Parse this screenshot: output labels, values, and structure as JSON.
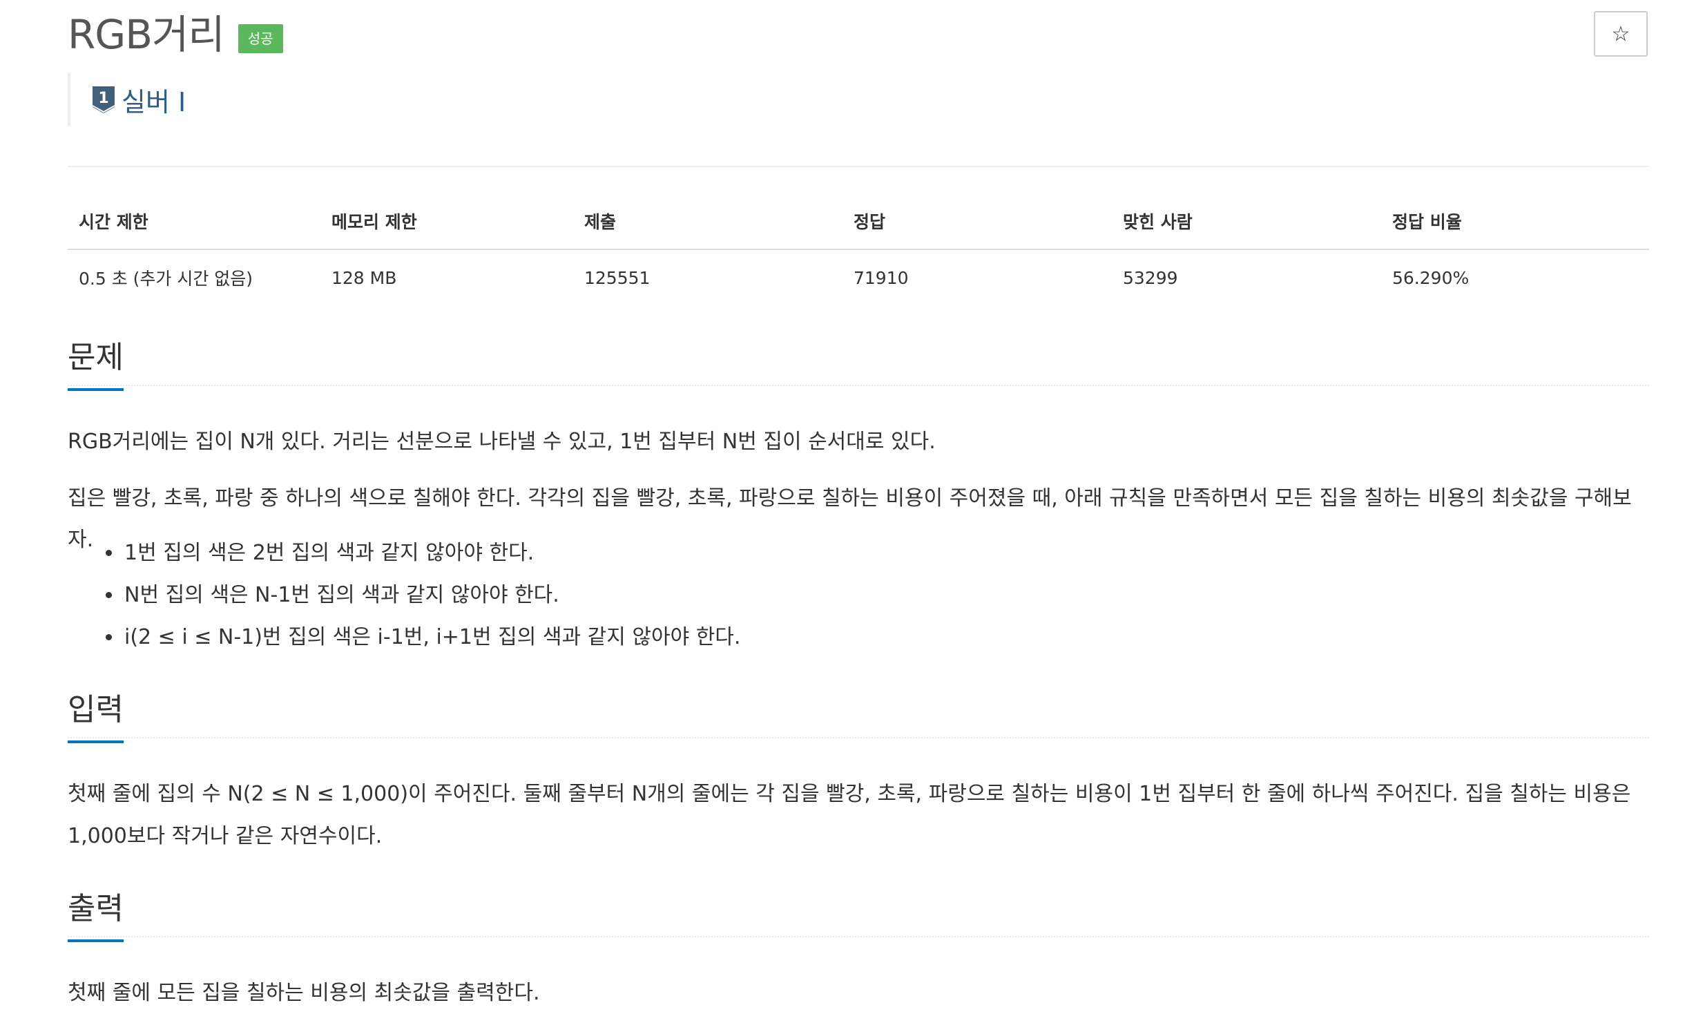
{
  "problem": {
    "title": "RGB거리",
    "status_badge": "성공",
    "tier_level": "1",
    "tier_label": "실버 I"
  },
  "info_table": {
    "headers": [
      "시간 제한",
      "메모리 제한",
      "제출",
      "정답",
      "맞힌 사람",
      "정답 비율"
    ],
    "values": [
      "0.5 초 (추가 시간 없음)",
      "128 MB",
      "125551",
      "71910",
      "53299",
      "56.290%"
    ]
  },
  "sections": {
    "problem": {
      "heading": "문제",
      "paragraphs": [
        "RGB거리에는 집이 N개 있다. 거리는 선분으로 나타낼 수 있고, 1번 집부터 N번 집이 순서대로 있다.",
        "집은 빨강, 초록, 파랑 중 하나의 색으로 칠해야 한다. 각각의 집을 빨강, 초록, 파랑으로 칠하는 비용이 주어졌을 때, 아래 규칙을 만족하면서 모든 집을 칠하는 비용의 최솟값을 구해보자."
      ],
      "rules": [
        "1번 집의 색은 2번 집의 색과 같지 않아야 한다.",
        "N번 집의 색은 N-1번 집의 색과 같지 않아야 한다.",
        "i(2 ≤ i ≤ N-1)번 집의 색은 i-1번, i+1번 집의 색과 같지 않아야 한다."
      ]
    },
    "input": {
      "heading": "입력",
      "lines": [
        "첫째 줄에 집의 수 N(2 ≤ N ≤ 1,000)이 주어진다. 둘째 줄부터 N개의 줄에는 각 집을 빨강, 초록, 파랑으로 칠하는 비용이 1번 집부터 한 줄에 하나씩 주어진다. 집을 칠하는 비용은",
        "1,000보다 작거나 같은 자연수이다."
      ]
    },
    "output": {
      "heading": "출력",
      "text": "첫째 줄에 모든 집을 칠하는 비용의 최솟값을 출력한다."
    }
  },
  "icons": {
    "star": "star-outline-icon",
    "tier": "silver-tier-shield-icon"
  },
  "colors": {
    "badge_success": "#5cb85c",
    "tier_text": "#2e5d86",
    "heading_underline": "#0076c0"
  }
}
